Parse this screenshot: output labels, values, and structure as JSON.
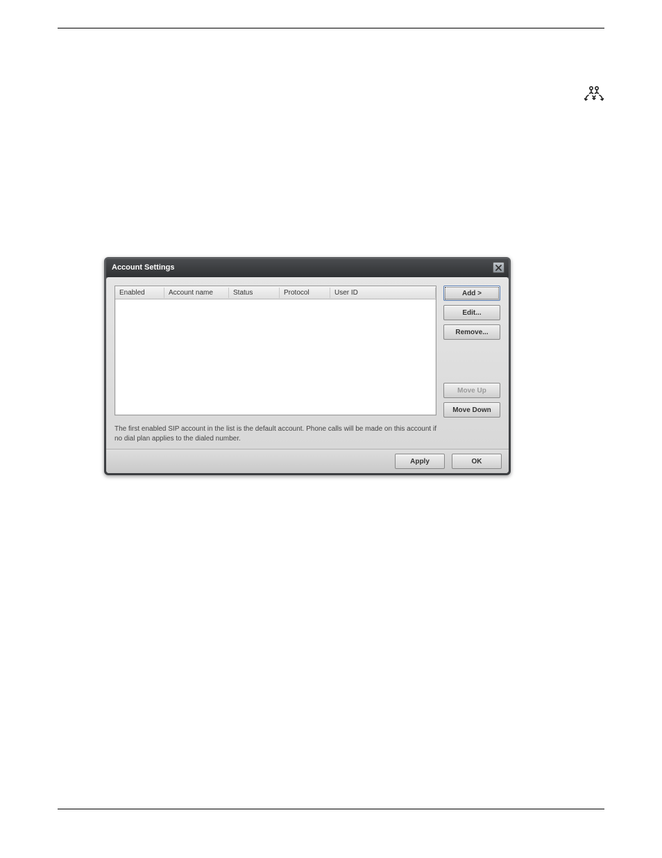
{
  "dialog": {
    "title": "Account Settings",
    "hint": "The first enabled SIP account in the list is the default account. Phone calls will be made on this account if no dial plan applies to the dialed number.",
    "columns": {
      "enabled": "Enabled",
      "account_name": "Account name",
      "status": "Status",
      "protocol": "Protocol",
      "user_id": "User ID"
    },
    "buttons": {
      "add": "Add >",
      "edit": "Edit...",
      "remove": "Remove...",
      "move_up": "Move Up",
      "move_down": "Move Down",
      "apply": "Apply",
      "ok": "OK"
    }
  }
}
